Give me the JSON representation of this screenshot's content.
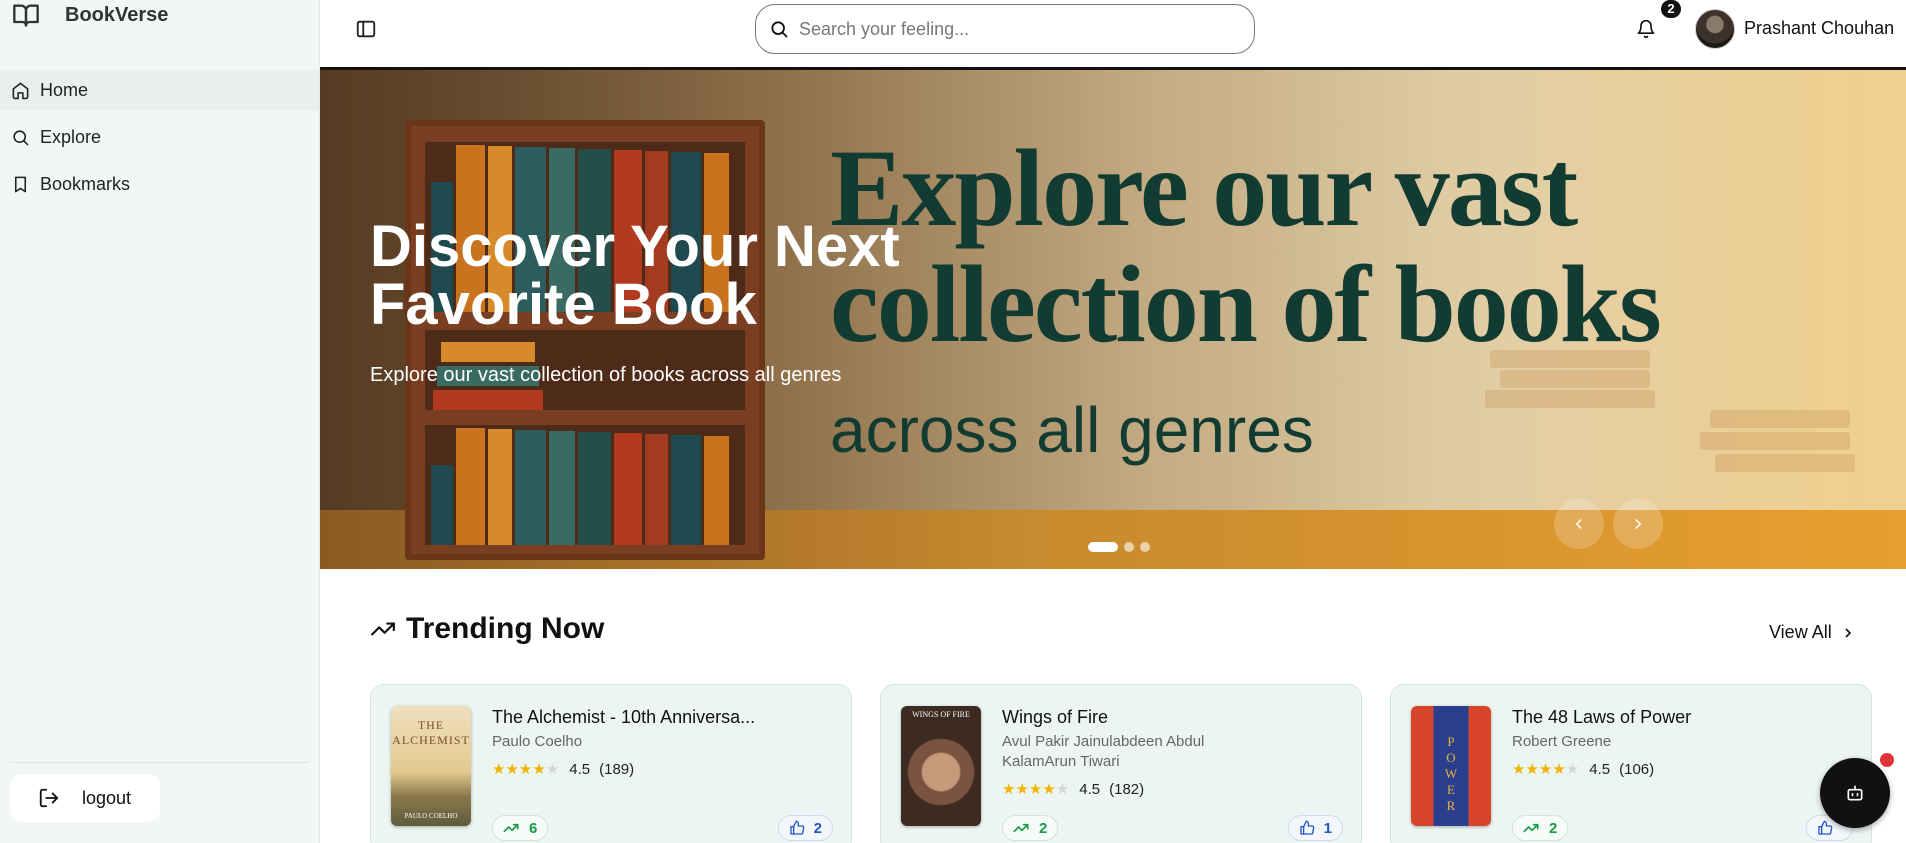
{
  "app": {
    "name": "BookVerse"
  },
  "sidebar": {
    "items": [
      {
        "label": "Home",
        "icon": "home-icon",
        "active": true
      },
      {
        "label": "Explore",
        "icon": "search-icon",
        "active": false
      },
      {
        "label": "Bookmarks",
        "icon": "bookmark-icon",
        "active": false
      }
    ],
    "logout_label": "logout"
  },
  "header": {
    "search_placeholder": "Search your feeling...",
    "notification_count": "2",
    "user_name": "Prashant Chouhan"
  },
  "hero": {
    "title": "Discover Your Next Favorite Book",
    "subtitle": "Explore our vast collection of books across all genres",
    "image_text_line1": "Explore our vast",
    "image_text_line2": "collection of books",
    "image_text_line3": "across all genres",
    "slides_total": 3,
    "active_slide": 1
  },
  "trending": {
    "title": "Trending Now",
    "view_all_label": "View All",
    "books": [
      {
        "title": "The Alchemist - 10th Anniversa...",
        "author": "Paulo Coelho",
        "rating": "4.5",
        "reviews": "(189)",
        "stars": 4,
        "trend_count": "6",
        "likes": "2",
        "cover_title": "THE ALCHEMIST",
        "cover_author": "PAULO COELHO",
        "cover_color": "#e6cfa0"
      },
      {
        "title": "Wings of Fire",
        "author": "Avul Pakir Jainulabdeen Abdul KalamArun Tiwari",
        "rating": "4.5",
        "reviews": "(182)",
        "stars": 4,
        "trend_count": "2",
        "likes": "1",
        "cover_title": "WINGS OF FIRE",
        "cover_author": "",
        "cover_color": "#6b4a36"
      },
      {
        "title": "The 48 Laws of Power",
        "author": "Robert Greene",
        "rating": "4.5",
        "reviews": "(106)",
        "stars": 4,
        "trend_count": "2",
        "likes": "",
        "cover_title": "POWER",
        "cover_author": "",
        "cover_color": "#d6452a"
      }
    ]
  },
  "colors": {
    "sidebar_bg": "#f1f7f7",
    "card_bg": "#ecf5f1",
    "trend_green": "#159a45",
    "like_blue": "#2457c5",
    "star_gold": "#f0b400",
    "fab_bg": "#111111",
    "fab_badge": "#e0323b"
  }
}
